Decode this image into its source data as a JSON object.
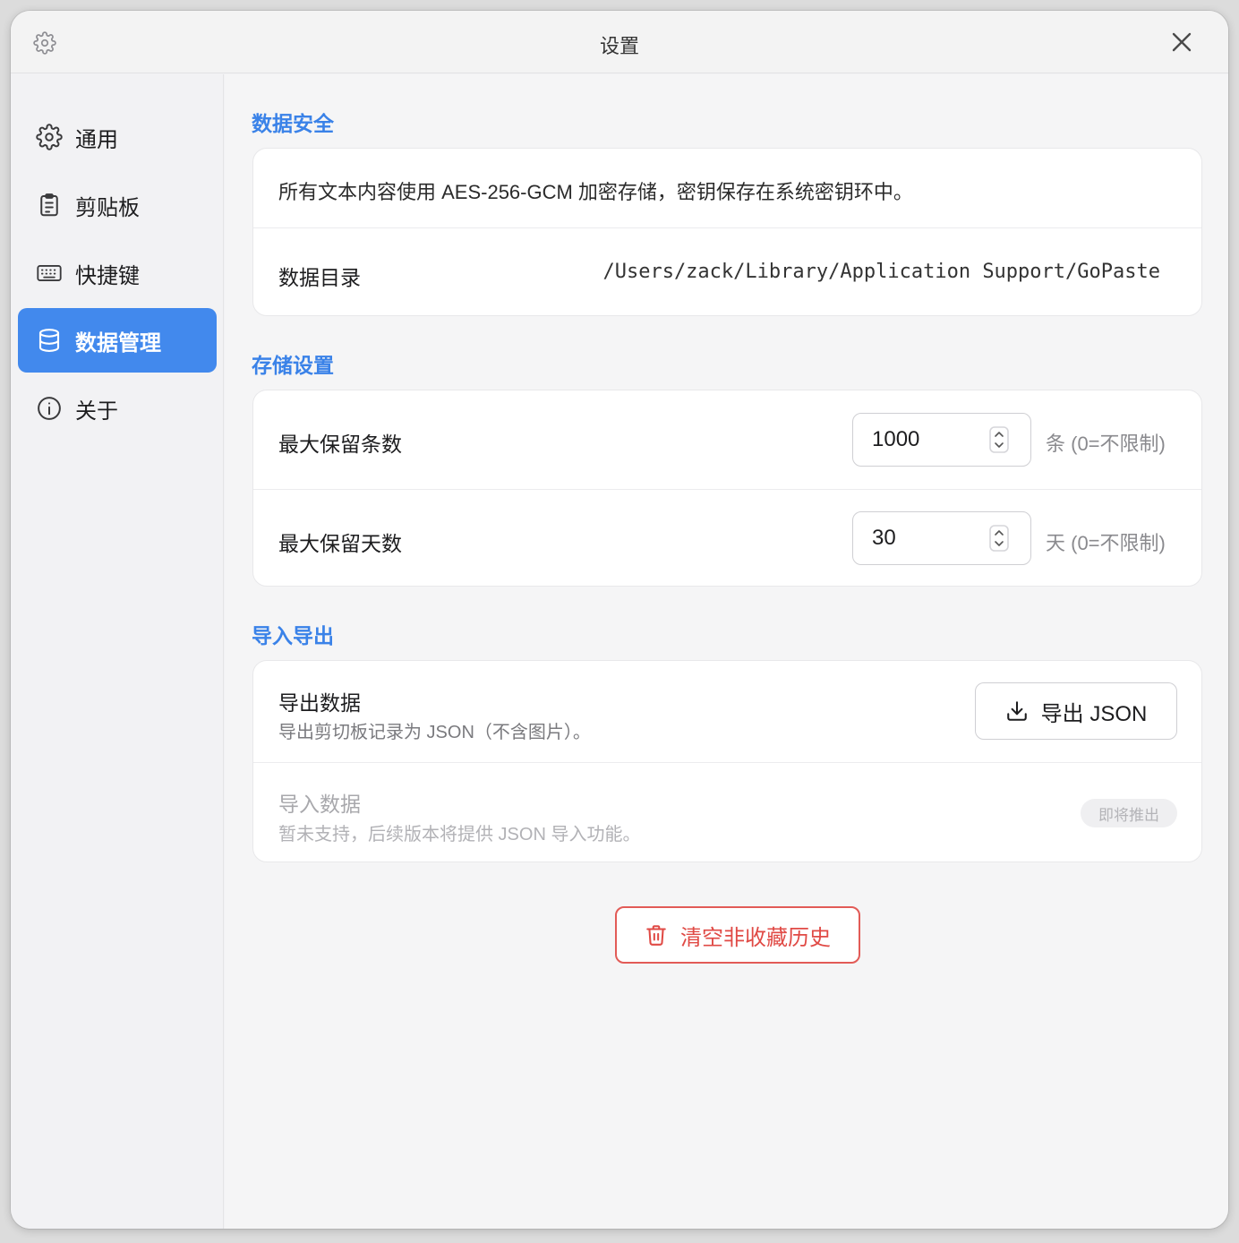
{
  "window": {
    "title": "设置"
  },
  "sidebar": {
    "items": [
      {
        "label": "通用",
        "icon": "gear-icon"
      },
      {
        "label": "剪贴板",
        "icon": "clipboard-icon"
      },
      {
        "label": "快捷键",
        "icon": "keyboard-icon"
      },
      {
        "label": "数据管理",
        "icon": "database-icon",
        "active": true
      },
      {
        "label": "关于",
        "icon": "info-icon"
      }
    ]
  },
  "sections": {
    "security": {
      "title": "数据安全",
      "description": "所有文本内容使用 AES-256-GCM 加密存储，密钥保存在系统密钥环中。",
      "dir_label": "数据目录",
      "dir_value": "/Users/zack/Library/Application Support/GoPaste"
    },
    "storage": {
      "title": "存储设置",
      "max_items_label": "最大保留条数",
      "max_items_value": "1000",
      "max_items_unit": "条 (0=不限制)",
      "max_days_label": "最大保留天数",
      "max_days_value": "30",
      "max_days_unit": "天 (0=不限制)"
    },
    "import_export": {
      "title": "导入导出",
      "export_label": "导出数据",
      "export_desc": "导出剪切板记录为 JSON（不含图片）。",
      "export_button": "导出 JSON",
      "import_label": "导入数据",
      "import_desc": "暂未支持，后续版本将提供 JSON 导入功能。",
      "import_badge": "即将推出"
    }
  },
  "actions": {
    "clear_button": "清空非收藏历史"
  },
  "colors": {
    "accent": "#4289ed",
    "section_title": "#3a82e8",
    "danger": "#e04a45"
  }
}
